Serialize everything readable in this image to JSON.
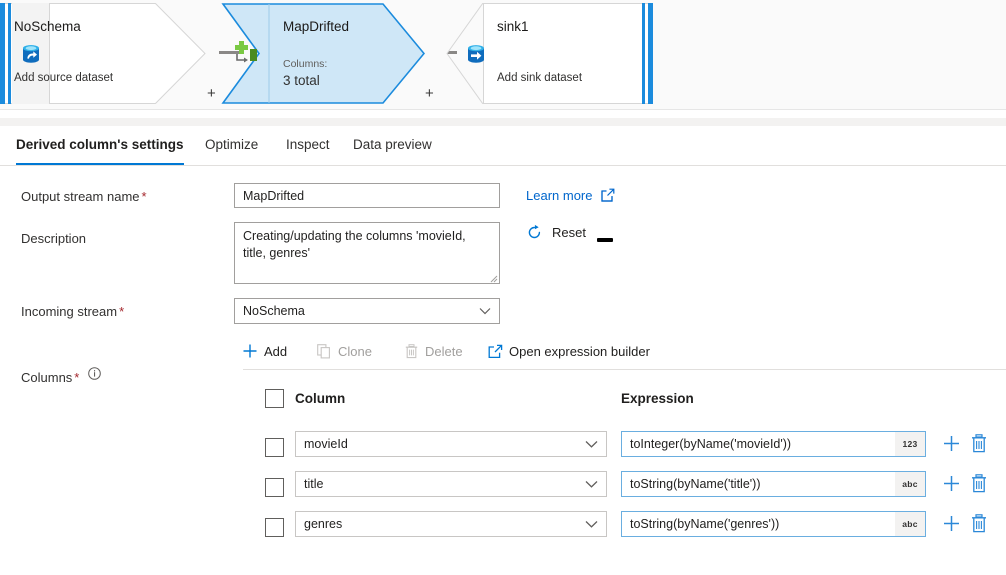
{
  "canvas": {
    "nodes": [
      {
        "id": "source",
        "name": "NoSchema",
        "sub": "Add source dataset",
        "icon": "source-dataset-icon",
        "plus": "+"
      },
      {
        "id": "derived-column",
        "name": "MapDrifted",
        "sub_label": "Columns:",
        "sub": "3 total",
        "icon": "derived-column-icon",
        "plus": "+"
      },
      {
        "id": "sink",
        "name": "sink1",
        "sub": "Add sink dataset",
        "icon": "sink-dataset-icon"
      }
    ],
    "drag_handle": "canvas-splitter-handle",
    "selected_accent": "#0078d4",
    "selected_fill": "#cfe7f7"
  },
  "tabs": [
    {
      "label": "Derived column's settings",
      "active": true
    },
    {
      "label": "Optimize",
      "active": false
    },
    {
      "label": "Inspect",
      "active": false
    },
    {
      "label": "Data preview",
      "active": false
    }
  ],
  "form": {
    "output_stream_name": {
      "label": "Output stream name",
      "required": "*",
      "value": "MapDrifted",
      "placeholder": ""
    },
    "description": {
      "label": "Description",
      "value": "Creating/updating the columns 'movieId, title, genres'",
      "placeholder": ""
    },
    "incoming_stream": {
      "label": "Incoming stream",
      "required": "*",
      "value": "NoSchema"
    },
    "columns": {
      "label": "Columns",
      "required": "*",
      "info_icon": "info-icon"
    },
    "learn_more": "Learn more",
    "reset": "Reset"
  },
  "toolbar": {
    "add": "Add",
    "clone": "Clone",
    "delete": "Delete",
    "open_expression_builder": "Open expression builder"
  },
  "table": {
    "headers": {
      "column": "Column",
      "expression": "Expression"
    },
    "rows": [
      {
        "column": "movieId",
        "expression": "toInteger(byName('movieId'))",
        "type": "123",
        "checked": false
      },
      {
        "column": "title",
        "expression": "toString(byName('title'))",
        "type": "abc",
        "checked": false
      },
      {
        "column": "genres",
        "expression": "toString(byName('genres'))",
        "type": "abc",
        "checked": false
      }
    ]
  },
  "colors": {
    "accent": "#0078d4",
    "link": "#0066cc",
    "required": "#a4262c",
    "node_selected_fill": "#cfe7f7",
    "expression_border": "#6aaee0",
    "disabled_text": "#a19f9d"
  }
}
